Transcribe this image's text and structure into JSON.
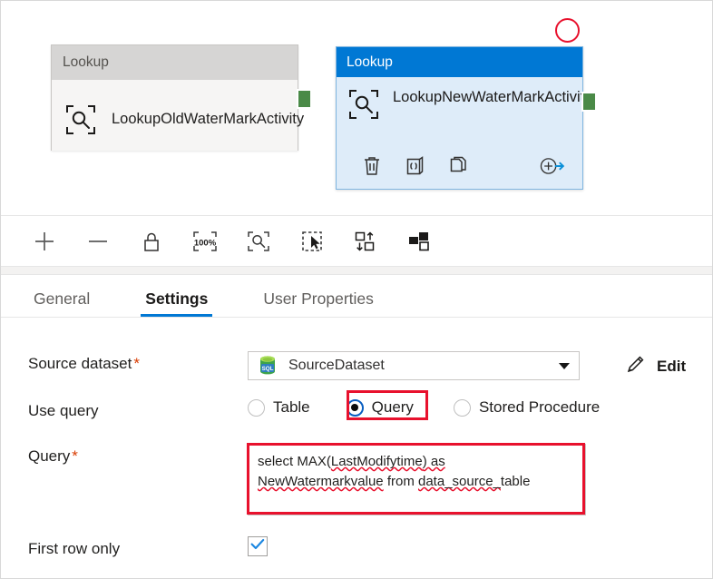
{
  "canvas": {
    "nodes": [
      {
        "id": "lookup-old",
        "header": "Lookup",
        "title": "LookupOldWaterMarkActivity",
        "icon": "lookup-magnifier-icon",
        "selected": false,
        "header_color": "#d6d5d4",
        "body_color": "#f6f5f4"
      },
      {
        "id": "lookup-new",
        "header": "Lookup",
        "title": "LookupNewWaterMarkActivity",
        "icon": "lookup-magnifier-icon",
        "selected": true,
        "header_color": "#0078d4",
        "body_color": "#deecf9",
        "actions": [
          {
            "name": "delete-activity",
            "icon": "trash-icon"
          },
          {
            "name": "view-code-activity",
            "icon": "code-braces-icon"
          },
          {
            "name": "clone-activity",
            "icon": "copy-icon"
          },
          {
            "name": "add-output-activity",
            "icon": "add-arrow-icon"
          }
        ]
      }
    ],
    "connector_color": "#4a8a47",
    "annotation_color": "#e8112d"
  },
  "toolbar": {
    "buttons": [
      {
        "name": "zoom-in-button",
        "icon": "plus-icon"
      },
      {
        "name": "zoom-out-button",
        "icon": "minus-icon"
      },
      {
        "name": "lock-canvas-button",
        "icon": "lock-icon"
      },
      {
        "name": "zoom-100-percent-button",
        "icon": "zoom-100-icon",
        "label": "100%"
      },
      {
        "name": "zoom-to-fit-button",
        "icon": "zoom-fit-icon"
      },
      {
        "name": "select-region-button",
        "icon": "marquee-cursor-icon"
      },
      {
        "name": "auto-align-button",
        "icon": "auto-align-icon"
      },
      {
        "name": "toggle-minimap-button",
        "icon": "minimap-icon"
      }
    ]
  },
  "tabs": [
    {
      "label": "General",
      "active": false
    },
    {
      "label": "Settings",
      "active": true
    },
    {
      "label": "User Properties",
      "active": false
    }
  ],
  "form": {
    "source_dataset": {
      "label": "Source dataset",
      "required": "*",
      "value": "SourceDataset",
      "icon": "sql-database-icon",
      "edit_label": "Edit",
      "edit_icon": "pencil-icon"
    },
    "use_query": {
      "label": "Use query",
      "options": [
        {
          "label": "Table",
          "selected": false
        },
        {
          "label": "Query",
          "selected": true
        },
        {
          "label": "Stored Procedure",
          "selected": false
        }
      ]
    },
    "query": {
      "label": "Query",
      "required": "*",
      "line1_a": "select MAX(",
      "line1_b": "LastModifytime",
      "line1_c": ") as",
      "line2_a": "NewWatermarkvalue",
      "line2_b": " from ",
      "line2_c": "data_source_",
      "line2_d": "table",
      "full_value": "select MAX(LastModifytime) as NewWatermarkvalue from data_source_table"
    },
    "first_row_only": {
      "label": "First row only",
      "checked": true,
      "check_color": "#0078d4"
    }
  }
}
